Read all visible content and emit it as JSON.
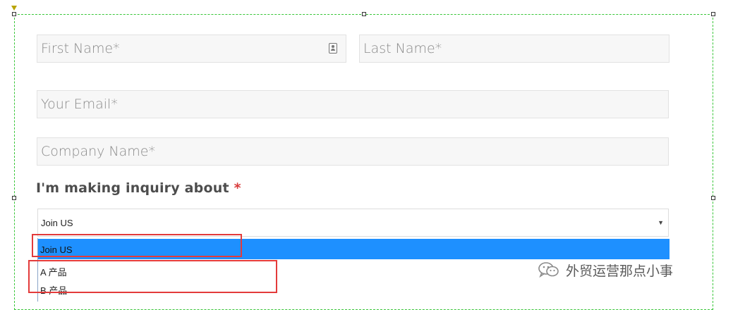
{
  "form": {
    "first_name_placeholder": "First Name*",
    "last_name_placeholder": "Last Name*",
    "email_placeholder": "Your Email*",
    "company_placeholder": "Company Name*",
    "inquiry_label": "I'm making inquiry about",
    "required_mark": "*",
    "select": {
      "selected_value": "Join US",
      "arrow": "▼",
      "options": [
        "Join US",
        "A 产品",
        "B 产品"
      ]
    }
  },
  "watermark": {
    "icon": "wechat-icon",
    "text": "外贸运营那点小事"
  },
  "colors": {
    "highlight": "#1e90ff",
    "annotation_red": "#e33b3b",
    "selection_frame": "#39c639",
    "required": "#d83a3a"
  }
}
